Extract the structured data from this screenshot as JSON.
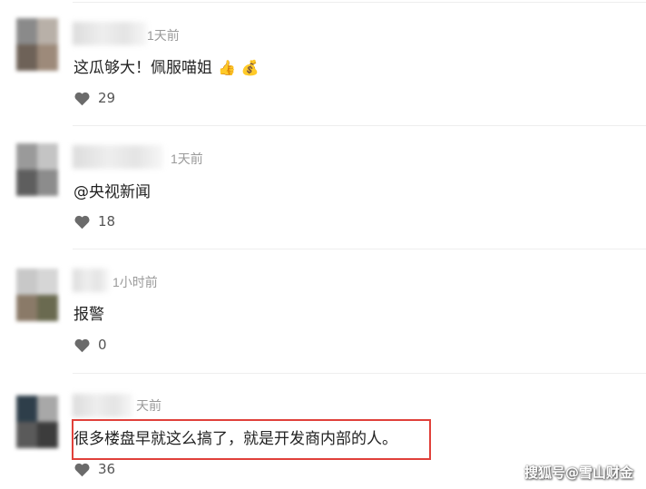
{
  "comments": [
    {
      "time": "1天前",
      "text": "这瓜够大！佩服喵姐",
      "emoji_1": "👍",
      "emoji_2": "💰",
      "likes": "29"
    },
    {
      "time": "1天前",
      "text": "@央视新闻",
      "likes": "18"
    },
    {
      "time": "1小时前",
      "text": "报警",
      "likes": "0"
    },
    {
      "time": "天前",
      "text": "很多楼盘早就这么搞了，就是开发商内部的人。",
      "likes": "36"
    }
  ],
  "watermark": "搜狐号@雪山财金",
  "colors": {
    "highlight": "#e0403a",
    "heart": "#6b6b6b",
    "divider": "#eeeeee"
  }
}
